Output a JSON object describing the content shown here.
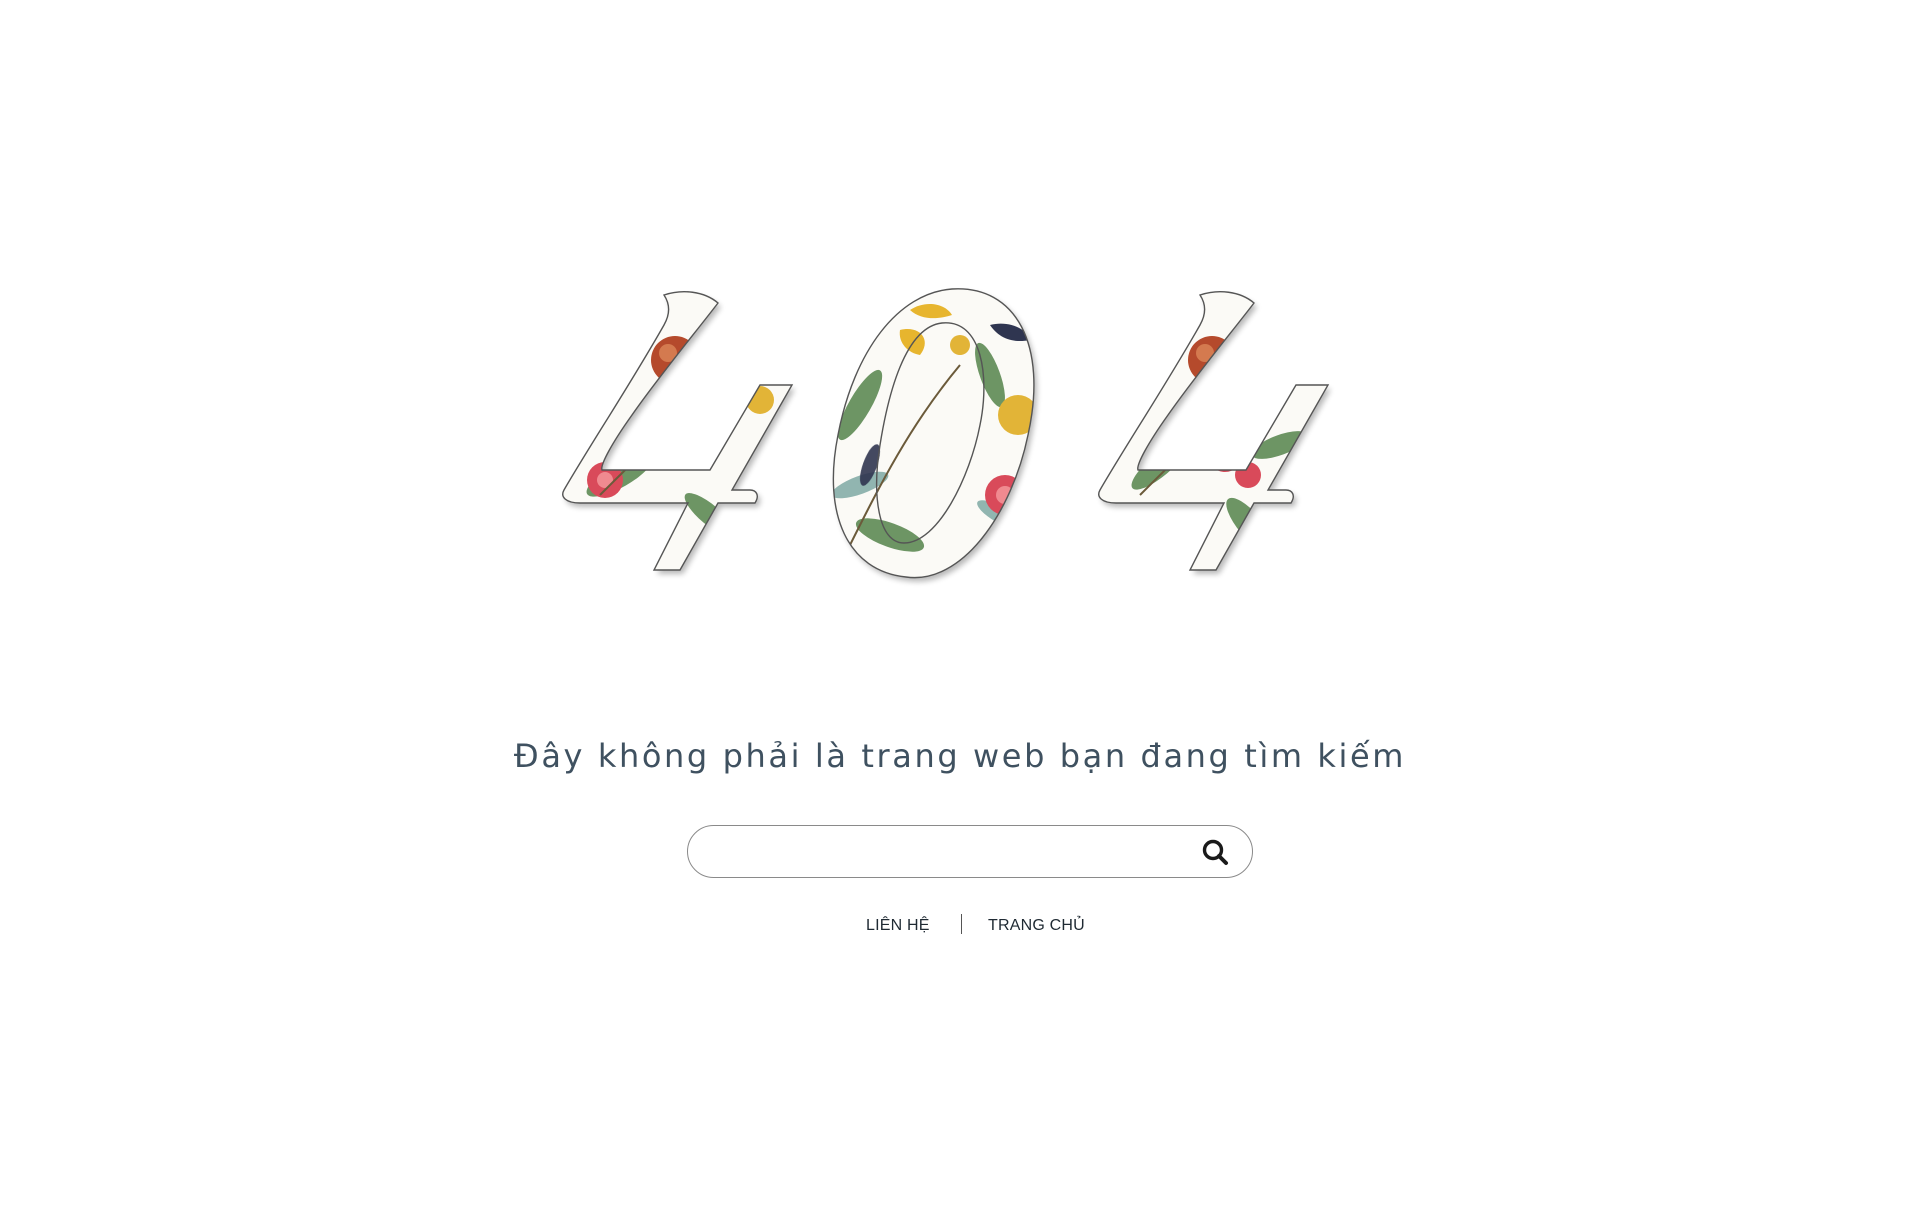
{
  "hero": {
    "error_code": "404",
    "colors": {
      "outline": "#555555",
      "petal_red": "#d94a5a",
      "fruit": "#b54a2c",
      "leaf_green": "#5e8a55",
      "leaf_teal": "#7ea8a3",
      "gold": "#e2b437",
      "bird_yellow": "#e7b52e",
      "navy": "#2f3550"
    }
  },
  "subtitle": "Đây không phải là trang web bạn đang tìm kiếm",
  "search": {
    "value": "",
    "placeholder": "",
    "icon": "search-icon"
  },
  "nav": {
    "contact_label": "LIÊN HỆ",
    "home_label": "TRANG CHỦ"
  }
}
